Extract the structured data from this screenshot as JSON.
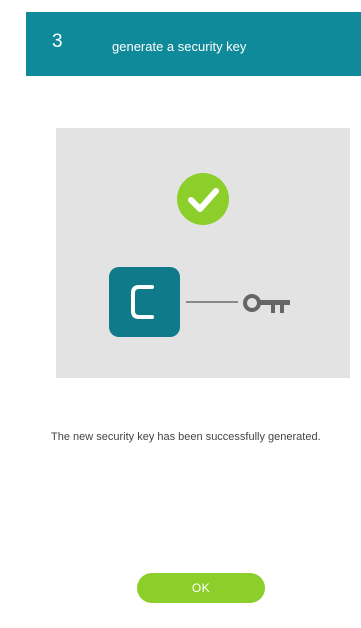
{
  "header": {
    "step_number": "3",
    "title": "generate a security key"
  },
  "illustration": {
    "status_icon": "check-circle-icon",
    "app_icon": "app-logo-c-icon",
    "key_icon": "key-icon"
  },
  "message": {
    "text": "The new security key has been successfully generated."
  },
  "actions": {
    "ok_label": "OK"
  },
  "colors": {
    "header": "#0f8a9a",
    "success": "#8ccf2a",
    "app_tile": "#0f7a8a",
    "key": "#666666",
    "panel": "#e3e3e3"
  }
}
